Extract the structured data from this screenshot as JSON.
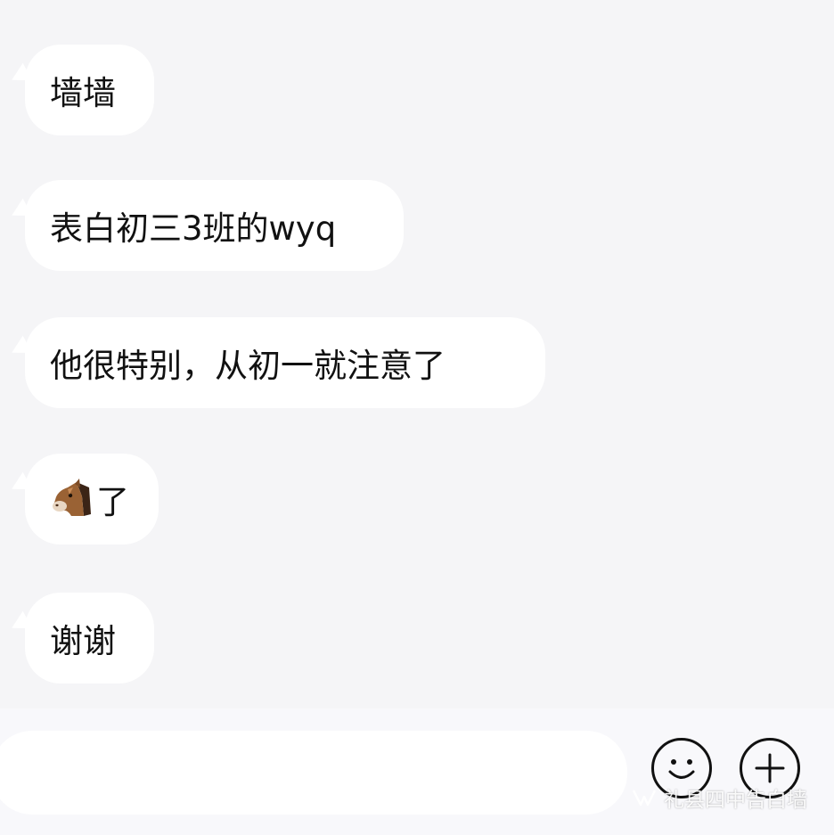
{
  "messages": [
    {
      "text": "墙墙"
    },
    {
      "text": "表白初三3班的wyq"
    },
    {
      "text": "他很特别，从初一就注意了"
    },
    {
      "text": "了",
      "emoji": "horse-face-icon"
    },
    {
      "text": "谢谢"
    }
  ],
  "composer": {
    "input_value": "",
    "emoji_button_icon": "smiley-icon",
    "plus_button_icon": "plus-circle-icon"
  },
  "watermark": {
    "text": "礼县四中告白墙",
    "icon": "wechat-channels-icon"
  },
  "colors": {
    "background": "#f5f5f7",
    "bubble": "#ffffff",
    "text": "#111111"
  }
}
